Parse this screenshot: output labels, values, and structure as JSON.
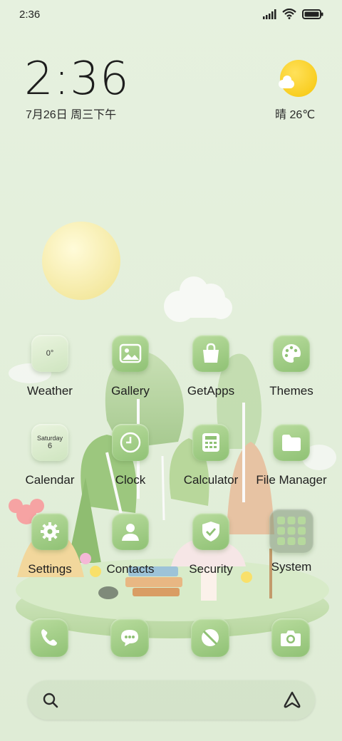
{
  "status_bar": {
    "time": "2:36"
  },
  "clock_widget": {
    "time": "2:36",
    "date": "7月26日 周三下午"
  },
  "weather_widget": {
    "text": "晴 26℃"
  },
  "apps": [
    {
      "label": "Weather",
      "sub_top": "0°",
      "sub_bottom": ""
    },
    {
      "label": "Gallery"
    },
    {
      "label": "GetApps"
    },
    {
      "label": "Themes"
    },
    {
      "label": "Calendar",
      "sub_top": "Saturday",
      "sub_bottom": "6"
    },
    {
      "label": "Clock"
    },
    {
      "label": "Calculator"
    },
    {
      "label": "File Manager"
    },
    {
      "label": "Settings"
    },
    {
      "label": "Contacts"
    },
    {
      "label": "Security"
    },
    {
      "label": "System"
    }
  ],
  "dock": [
    "phone-icon",
    "messages-icon",
    "browser-icon",
    "camera-icon"
  ],
  "search": {
    "left_icon": "search-icon",
    "right_icon": "assistant-icon"
  },
  "colors": {
    "accent": "#9ccb80",
    "background": "#e4efdb"
  }
}
